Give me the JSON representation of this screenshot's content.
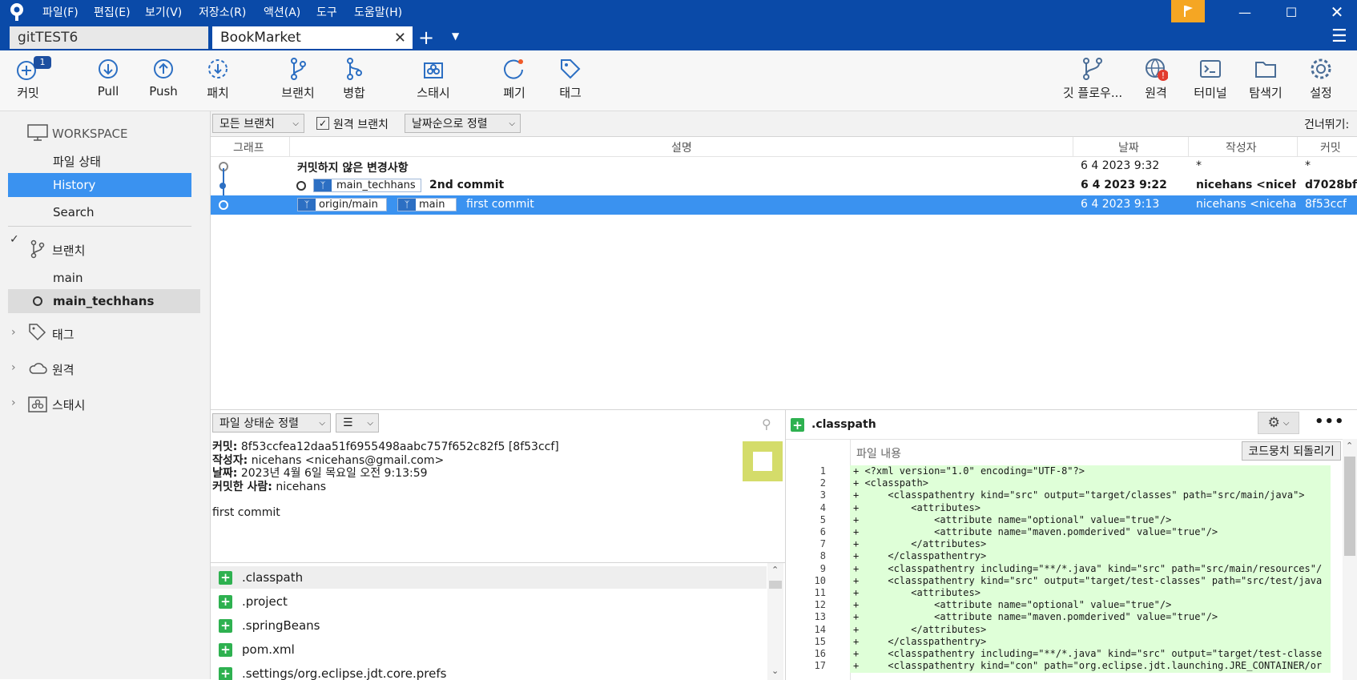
{
  "titlebar": {
    "menus": [
      "파일(F)",
      "편집(E)",
      "보기(V)",
      "저장소(R)",
      "액션(A)",
      "도구",
      "도움말(H)"
    ],
    "accent": "#0a4aa8",
    "flag_color": "#f5a623"
  },
  "tabs": [
    {
      "label": "gitTEST6"
    },
    {
      "label": "BookMarket"
    }
  ],
  "toolbar": {
    "commit": "커밋",
    "commit_badge": "1",
    "pull": "Pull",
    "push": "Push",
    "fetch": "패치",
    "branch": "브랜치",
    "merge": "병합",
    "stash": "스태시",
    "discard": "폐기",
    "tag": "태그",
    "gitflow": "깃 플로우...",
    "remote": "원격",
    "terminal": "터미널",
    "explorer": "탐색기",
    "settings": "설정"
  },
  "sidebar": {
    "workspace": "WORKSPACE",
    "file_status": "파일 상태",
    "history": "History",
    "search": "Search",
    "branches_label": "브랜치",
    "branches": [
      "main",
      "main_techhans"
    ],
    "tags_label": "태그",
    "remotes_label": "원격",
    "stashes_label": "스태시"
  },
  "filterbar": {
    "all_branches": "모든 브랜치",
    "remote_branches": "원격 브랜치",
    "sort": "날짜순으로 정렬",
    "skip": "건너뛰기:"
  },
  "columns": {
    "graph": "그래프",
    "description": "설명",
    "date": "날짜",
    "author": "작성자",
    "commit": "커밋"
  },
  "commits": [
    {
      "desc": "커밋하지 않은 변경사항",
      "date": "6 4 2023 9:32",
      "author": "*",
      "hash": "*"
    },
    {
      "branch": "main_techhans",
      "desc": "2nd commit",
      "date": "6 4 2023 9:22",
      "author": "nicehans <niceha",
      "hash": "d7028bf"
    },
    {
      "branch1": "origin/main",
      "branch2": "main",
      "desc": "first commit",
      "date": "6 4 2023 9:13",
      "author": "nicehans <nicehar",
      "hash": "8f53ccf"
    }
  ],
  "details": {
    "sort_label": "파일 상태순 정렬",
    "commit_label": "커밋:",
    "commit_value": "8f53ccfea12daa51f6955498aabc757f652c82f5 [8f53ccf]",
    "author_label": "작성자:",
    "author_value": "nicehans <nicehans@gmail.com>",
    "date_label": "날짜:",
    "date_value": "2023년 4월 6일 목요일 오전 9:13:59",
    "committer_label": "커밋한 사람:",
    "committer_value": "nicehans",
    "message": "first commit"
  },
  "files": [
    ".classpath",
    ".project",
    ".springBeans",
    "pom.xml",
    ".settings/org.eclipse.jdt.core.prefs"
  ],
  "diff": {
    "filename": ".classpath",
    "content_label": "파일 내용",
    "revert_button": "코드뭉치 되돌리기",
    "lines": [
      {
        "n": "1",
        "t": "+ <?xml version=\"1.0\" encoding=\"UTF-8\"?>"
      },
      {
        "n": "2",
        "t": "+ <classpath>"
      },
      {
        "n": "3",
        "t": "+     <classpathentry kind=\"src\" output=\"target/classes\" path=\"src/main/java\">"
      },
      {
        "n": "4",
        "t": "+         <attributes>"
      },
      {
        "n": "5",
        "t": "+             <attribute name=\"optional\" value=\"true\"/>"
      },
      {
        "n": "6",
        "t": "+             <attribute name=\"maven.pomderived\" value=\"true\"/>"
      },
      {
        "n": "7",
        "t": "+         </attributes>"
      },
      {
        "n": "8",
        "t": "+     </classpathentry>"
      },
      {
        "n": "9",
        "t": "+     <classpathentry including=\"**/*.java\" kind=\"src\" path=\"src/main/resources\"/"
      },
      {
        "n": "10",
        "t": "+     <classpathentry kind=\"src\" output=\"target/test-classes\" path=\"src/test/java"
      },
      {
        "n": "11",
        "t": "+         <attributes>"
      },
      {
        "n": "12",
        "t": "+             <attribute name=\"optional\" value=\"true\"/>"
      },
      {
        "n": "13",
        "t": "+             <attribute name=\"maven.pomderived\" value=\"true\"/>"
      },
      {
        "n": "14",
        "t": "+         </attributes>"
      },
      {
        "n": "15",
        "t": "+     </classpathentry>"
      },
      {
        "n": "16",
        "t": "+     <classpathentry including=\"**/*.java\" kind=\"src\" output=\"target/test-classe"
      },
      {
        "n": "17",
        "t": "+     <classpathentry kind=\"con\" path=\"org.eclipse.jdt.launching.JRE_CONTAINER/or"
      }
    ]
  }
}
